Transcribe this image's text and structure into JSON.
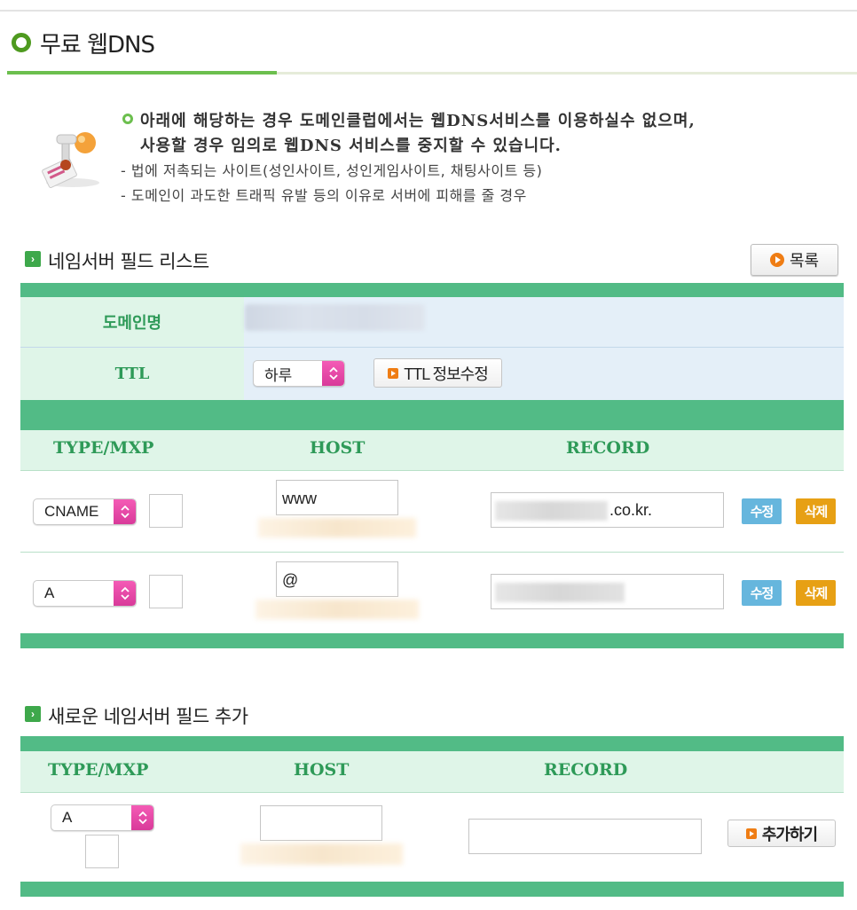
{
  "page": {
    "title": "무료 웹DNS"
  },
  "notice": {
    "line1": "아래에 해당하는 경우 도메인클럽에서는 웹DNS서비스를 이용하실수 없으며,",
    "line2": "사용할 경우 임의로 웹DNS 서비스를 중지할 수 있습니다.",
    "line3": "- 법에 저촉되는 사이트(성인사이트, 성인게임사이트, 채팅사이트 등)",
    "line4": "- 도메인이 과도한 트래픽 유발 등의 이유로 서버에 피해를 줄 경우"
  },
  "nameserver_list": {
    "section_title": "네임서버 필드 리스트",
    "list_button": "목록",
    "domain_label": "도메인명",
    "ttl_label": "TTL",
    "ttl_value": "하루",
    "ttl_edit_button": "TTL 정보수정",
    "headers": {
      "type": "TYPE/MXP",
      "host": "HOST",
      "record": "RECORD"
    },
    "rows": [
      {
        "type": "CNAME",
        "host": "www",
        "record_suffix": ".co.kr.",
        "edit": "수정",
        "delete": "삭제"
      },
      {
        "type": "A",
        "host": "@",
        "record_suffix": "",
        "edit": "수정",
        "delete": "삭제"
      }
    ]
  },
  "add_field": {
    "section_title": "새로운 네임서버 필드 추가",
    "headers": {
      "type": "TYPE/MXP",
      "host": "HOST",
      "record": "RECORD"
    },
    "type_value": "A",
    "add_button": "추가하기"
  },
  "colors": {
    "band": "#52bb86",
    "label_bg": "#dff5e8",
    "label_text": "#2e9a58",
    "edit": "#66b6dd",
    "delete": "#e7a014",
    "select_arrow": "#e04aa6"
  }
}
